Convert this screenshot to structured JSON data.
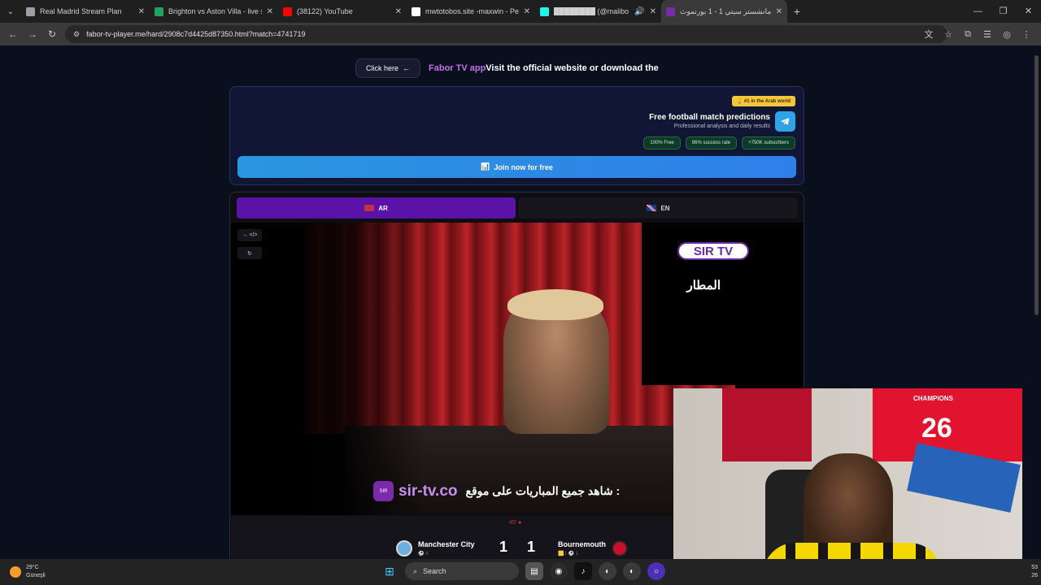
{
  "browser": {
    "tabs": [
      {
        "title": "Real Madrid Stream Plan",
        "color": "#9aa0a6",
        "active": false
      },
      {
        "title": "Brighton vs Aston Villa - live sc",
        "color": "#1ea362",
        "active": false
      },
      {
        "title": "(38122) YouTube",
        "color": "#ff0000",
        "active": false
      },
      {
        "title": "mwtotobos.site -maxwin - Pene",
        "color": "#ffffff",
        "active": false
      },
      {
        "title": "████████ (@malibo",
        "color": "#25f4ee",
        "active": false
      },
      {
        "title": "مانشستر سيتي 1 - 1 بورنموث | S",
        "color": "#7b2aa9",
        "active": true
      }
    ],
    "url": "fabor-tv-player.me/hard/2908c7d4425d87350.html?match=4741719"
  },
  "promo": {
    "button_label": "Click here",
    "text_app": "Fabor TV app",
    "text_rest": "Visit the official website or download the"
  },
  "telegram_card": {
    "badge": "#1 in the Arab world",
    "title": "Free football match predictions",
    "subtitle": "Professional analysis and daily results",
    "pills": [
      "100% Free",
      "96% success rate",
      "+750K subscribers"
    ],
    "join_label": "Join now for free"
  },
  "player": {
    "lang_tabs": [
      {
        "label": "AR",
        "active": true
      },
      {
        "label": "EN",
        "active": false
      }
    ],
    "ctrl_1": "→ </>",
    "ctrl_2": "↻",
    "overlay": {
      "channel": "SIR TV",
      "channel_sub": "المطار",
      "site": "sir-tv.co",
      "arabic": "شاهد جميع المباريات على موقع :"
    },
    "score": {
      "minute": "45' ●",
      "home_team": "Manchester City",
      "home_sub": "⚽ 4",
      "away_team": "Bournemouth",
      "away_sub": "🟨1 ⚽ 1",
      "home_score": "1",
      "away_score": "1"
    }
  },
  "webcam": {
    "jersey_text": "26",
    "jersey_top": "CHAMPIONS"
  },
  "taskbar": {
    "temp": "29°C",
    "weather": "Güneşli",
    "search": "Search",
    "time": "53",
    "date": "26"
  }
}
